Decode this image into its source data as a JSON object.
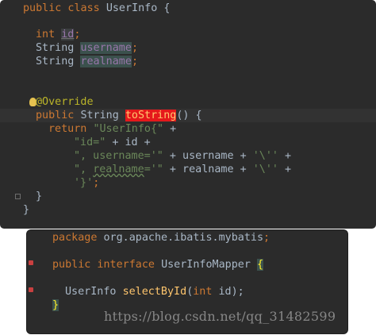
{
  "top_editor": {
    "class_line": {
      "kw": "public class ",
      "name": "UserInfo {"
    },
    "field_id": {
      "type": "int ",
      "name": "id",
      "end": ";"
    },
    "field_username": {
      "type": "String ",
      "name": "username",
      "end": ";"
    },
    "field_realname": {
      "type": "String ",
      "name": "realname",
      "end": ";"
    },
    "annotation": "@Override",
    "method_sig": {
      "kw": "public ",
      "type": "String ",
      "name": "toString",
      "params": "() {"
    },
    "return_line": {
      "kw": "return ",
      "str": "\"UserInfo{\"",
      "rest": " +"
    },
    "id_line": {
      "str": "\"id=\"",
      "mid": " + id +"
    },
    "username_line": {
      "str1": "\", username='\"",
      "mid": " + username + ",
      "str2": "'\\''",
      "end": " +"
    },
    "realname_line": {
      "str1a": "\", ",
      "str1b": "realname",
      "str1c": "='\"",
      "mid": " + realname + ",
      "str2": "'\\''",
      "end": " +"
    },
    "close_str_line": {
      "str": "'}'",
      "end": ";"
    },
    "method_close": "}",
    "class_close": "}"
  },
  "bottom_editor": {
    "package_line": {
      "kw": "package ",
      "name": "org.apache.ibatis.mybatis",
      "end": ";"
    },
    "interface_line": {
      "kw": "public interface ",
      "name": "UserInfoMapper ",
      "brace": "{"
    },
    "method_line": {
      "type": "UserInfo ",
      "name": "selectById",
      "open": "(",
      "ptype": "int ",
      "pname": "id",
      "close": ");"
    },
    "close_line": "}"
  },
  "watermark": "https://blog.csdn.net/qq_31482599"
}
